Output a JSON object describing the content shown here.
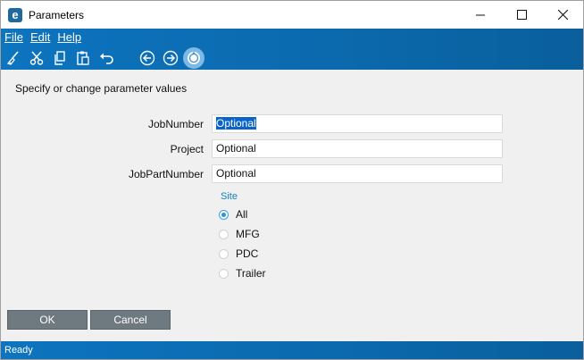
{
  "window": {
    "title": "Parameters",
    "app_icon_letter": "e",
    "controls": {
      "minimize": "—",
      "maximize": "☐",
      "close": "✕"
    }
  },
  "menu": {
    "items": [
      {
        "label": "File"
      },
      {
        "label": "Edit"
      },
      {
        "label": "Help"
      }
    ]
  },
  "toolbar": {
    "buttons": [
      "clear-icon",
      "cut-icon",
      "copy-icon",
      "paste-icon",
      "undo-icon",
      "back-arrow-icon",
      "forward-arrow-icon",
      "refresh-icon"
    ]
  },
  "form": {
    "instruction": "Specify or change parameter values",
    "fields": [
      {
        "label": "JobNumber",
        "value": "Optional",
        "selected": true
      },
      {
        "label": "Project",
        "value": "Optional"
      },
      {
        "label": "JobPartNumber",
        "value": "Optional"
      }
    ],
    "site": {
      "title": "Site",
      "options": [
        {
          "label": "All",
          "checked": true
        },
        {
          "label": "MFG",
          "checked": false
        },
        {
          "label": "PDC",
          "checked": false
        },
        {
          "label": "Trailer",
          "checked": false
        }
      ]
    }
  },
  "buttons": {
    "ok": "OK",
    "cancel": "Cancel"
  },
  "status": {
    "text": "Ready"
  },
  "colors": {
    "band": "#0b6aae",
    "button_gray": "#6f7a80",
    "accent": "#1580c8",
    "selection": "#0a64c8"
  }
}
